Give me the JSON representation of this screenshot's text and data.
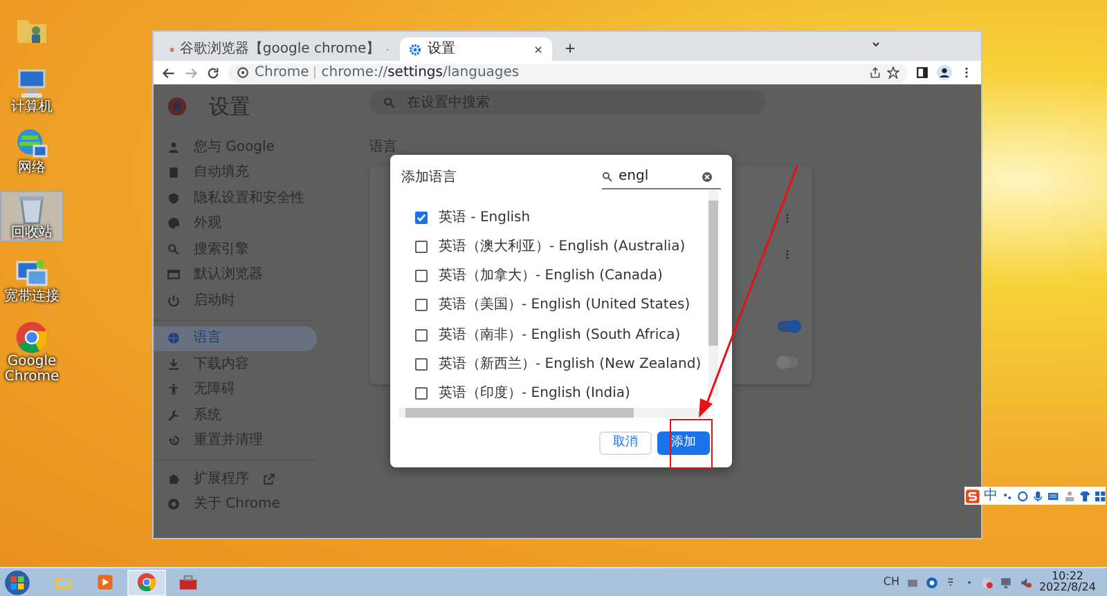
{
  "desktop_icons": [
    {
      "kind": "user-folder",
      "selected": false
    },
    {
      "kind": "computer",
      "label": "计算机",
      "selected": false
    },
    {
      "kind": "network",
      "label": "网络",
      "selected": false
    },
    {
      "kind": "recycle-bin",
      "label": "回收站",
      "selected": true
    },
    {
      "kind": "broadband",
      "label": "宽带连接",
      "selected": false
    },
    {
      "kind": "chrome",
      "label": "Google Chrome",
      "selected": false
    }
  ],
  "browser": {
    "tabs": [
      {
        "kind": "chrome",
        "title": "谷歌浏览器【google chrome】",
        "selected": false
      },
      {
        "kind": "gear",
        "title": "设置",
        "selected": true
      }
    ],
    "address": {
      "site": "Chrome",
      "url": "chrome://**settings**/languages"
    },
    "settings": {
      "title": "设置",
      "search": {
        "placeholder": "在设置中搜索"
      },
      "sidebar": [
        {
          "kind": "person",
          "label": "您与 Google",
          "selected": false
        },
        {
          "kind": "clipboard",
          "label": "自动填充",
          "selected": false
        },
        {
          "kind": "shield",
          "label": "隐私设置和安全性",
          "selected": false
        },
        {
          "kind": "palette",
          "label": "外观",
          "selected": false
        },
        {
          "kind": "search",
          "label": "搜索引擎",
          "selected": false
        },
        {
          "kind": "browser",
          "label": "默认浏览器",
          "selected": false
        },
        {
          "kind": "power",
          "label": "启动时",
          "selected": false
        },
        {
          "kind": "globe",
          "label": "语言",
          "selected": true
        },
        {
          "kind": "download",
          "label": "下载内容",
          "selected": false
        },
        {
          "kind": "accessibility",
          "label": "无障碍",
          "selected": false
        },
        {
          "kind": "wrench",
          "label": "系统",
          "selected": false
        },
        {
          "kind": "history",
          "label": "重置并清理",
          "selected": false
        },
        {
          "kind": "puzzle",
          "label": "扩展程序",
          "selected": false,
          "external": true
        },
        {
          "kind": "chrome",
          "label": "关于 Chrome",
          "selected": false
        }
      ],
      "section_title": "语言",
      "toggles": [
        {
          "on": true
        },
        {
          "on": false
        }
      ]
    }
  },
  "dialog": {
    "title": "添加语言",
    "search": {
      "value": "engl"
    },
    "languages": [
      {
        "label": "英语 - English",
        "checked": true
      },
      {
        "label": "英语（澳大利亚）- English (Australia)",
        "checked": false
      },
      {
        "label": "英语（加拿大）- English (Canada)",
        "checked": false
      },
      {
        "label": "英语（美国）- English (United States)",
        "checked": false
      },
      {
        "label": "英语（南非）- English (South Africa)",
        "checked": false
      },
      {
        "label": "英语（新西兰）- English (New Zealand)",
        "checked": false
      },
      {
        "label": "英语（印度）- English (India)",
        "checked": false
      }
    ],
    "buttons": [
      {
        "kind": "cancel",
        "label": "取消"
      },
      {
        "kind": "primary",
        "label": "添加"
      }
    ]
  },
  "ime_bar": {
    "mode": "中"
  },
  "taskbar": {
    "items": [
      {
        "kind": "explorer",
        "active": false
      },
      {
        "kind": "media",
        "active": false
      },
      {
        "kind": "chrome",
        "active": true
      },
      {
        "kind": "toolbox",
        "active": false
      }
    ],
    "language": "CH",
    "time": "10:22",
    "date": "2022/8/24"
  }
}
